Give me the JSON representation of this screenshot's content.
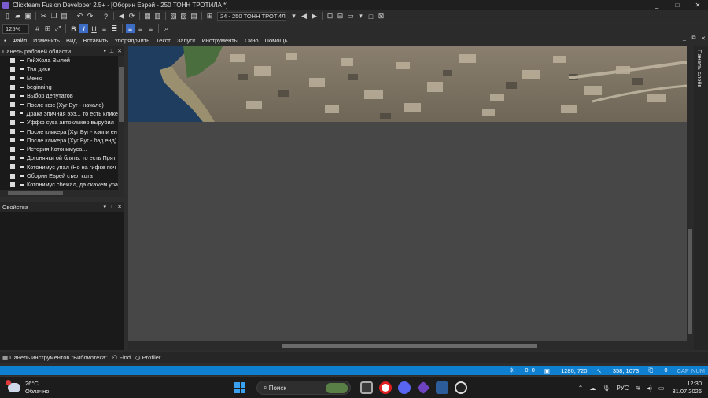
{
  "window": {
    "title": "Clickteam Fusion Developer 2.5+ - [Оборин Еврей - 250 ТОНН ТРОТИЛА *]",
    "controls": [
      "_",
      "□",
      "✕"
    ]
  },
  "toolbar": {
    "zoom": "125%",
    "frame_select": "24 - 250 ТОНН ТРОТИЛ"
  },
  "menu": {
    "items": [
      "Файл",
      "Изменить",
      "Вид",
      "Вставить",
      "Упорядочить",
      "Текст",
      "Запуск",
      "Инструменты",
      "Окно",
      "Помощь"
    ],
    "controls": [
      "_",
      "⧉",
      "✕"
    ]
  },
  "workspace_panel": {
    "title": "Панель рабочей области",
    "items": [
      "ГейЖола Вылей",
      "Тил диск",
      "Меню",
      "beginning",
      "Выбор депутатов",
      "После кфс (Хуг Вуг - начало)",
      "Драка эпичная эээ... то есть клике",
      "Уффф сука автокликер вырубил",
      "После кликера (Хуг Вуг - хэппи ен",
      "После кликера (Хуг Вуг - бэд енд)",
      "История Котонимуса...",
      "Догоняяки ой блять, то есть Прят",
      "Котонимус упал (Но на гифке поч",
      "Оборин Еврей съел кота",
      "Котонимус сбежал, да скажем ура"
    ]
  },
  "properties_panel": {
    "title": "Свойства"
  },
  "side_panel": {
    "label": "Панель слоёв"
  },
  "bottom_tabs": [
    {
      "label": "Панель инструментов \"Библиотека\"",
      "icon": "library-icon"
    },
    {
      "label": "Find",
      "icon": "binoculars-icon"
    },
    {
      "label": "Profiler",
      "icon": "clock-icon"
    }
  ],
  "status_bar": {
    "layer": "0, 0",
    "frame_size": "1280, 720",
    "cursor": "358, 1073",
    "objects": "0",
    "caps": "CAP",
    "num": "NUM"
  },
  "taskbar": {
    "weather_temp": "26°C",
    "weather_desc": "Облачно",
    "weather_badge": "1",
    "search_label": "Поиск",
    "lang": "РУС",
    "time": "12:30",
    "date": "31.07.2026"
  },
  "colors": {
    "accent": "#0f7fd0",
    "highlight": "#3d6cc4"
  }
}
